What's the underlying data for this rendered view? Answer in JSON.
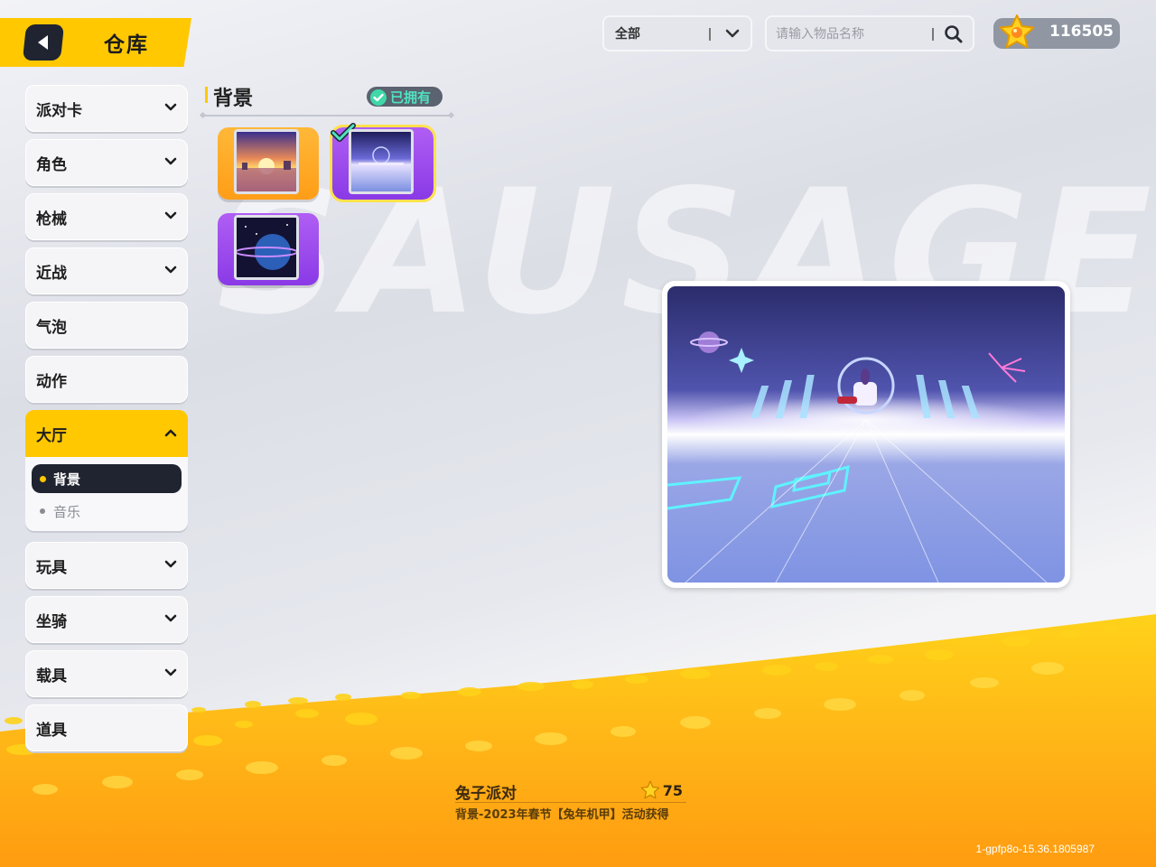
{
  "header": {
    "title": "仓库",
    "back_icon": "back-arrow-icon"
  },
  "filter": {
    "selected": "全部",
    "options": [
      "全部"
    ]
  },
  "search": {
    "placeholder": "请输入物品名称",
    "value": ""
  },
  "currency": {
    "icon": "star-coin-icon",
    "amount": "116505"
  },
  "sidebar": {
    "categories": [
      {
        "label": "派对卡",
        "expandable": true
      },
      {
        "label": "角色",
        "expandable": true
      },
      {
        "label": "枪械",
        "expandable": true
      },
      {
        "label": "近战",
        "expandable": true
      },
      {
        "label": "气泡",
        "expandable": false
      },
      {
        "label": "动作",
        "expandable": false
      },
      {
        "label": "大厅",
        "expandable": true,
        "expanded": true
      },
      {
        "label": "玩具",
        "expandable": true
      },
      {
        "label": "坐骑",
        "expandable": true
      },
      {
        "label": "载具",
        "expandable": true
      },
      {
        "label": "道具",
        "expandable": false
      }
    ],
    "sub_items": [
      {
        "label": "背景",
        "selected": true
      },
      {
        "label": "音乐",
        "selected": false
      }
    ]
  },
  "section": {
    "title": "背景",
    "owned_label": "已拥有"
  },
  "items": [
    {
      "name": "sunset-background-item",
      "rarity_color": "#ffa726",
      "selected": false,
      "equipped": false
    },
    {
      "name": "neon-stage-background-item",
      "rarity_color": "#9b4cf0",
      "selected": true,
      "equipped": true
    },
    {
      "name": "planet-background-item",
      "rarity_color": "#9b4cf0",
      "selected": false,
      "equipped": false
    }
  ],
  "detail": {
    "name": "兔子派对",
    "price": "75",
    "description": "背景-2023年春节【兔年机甲】活动获得"
  },
  "watermark": "SAUSAGE",
  "version": "1-gpfp8o-15.36.1805987"
}
